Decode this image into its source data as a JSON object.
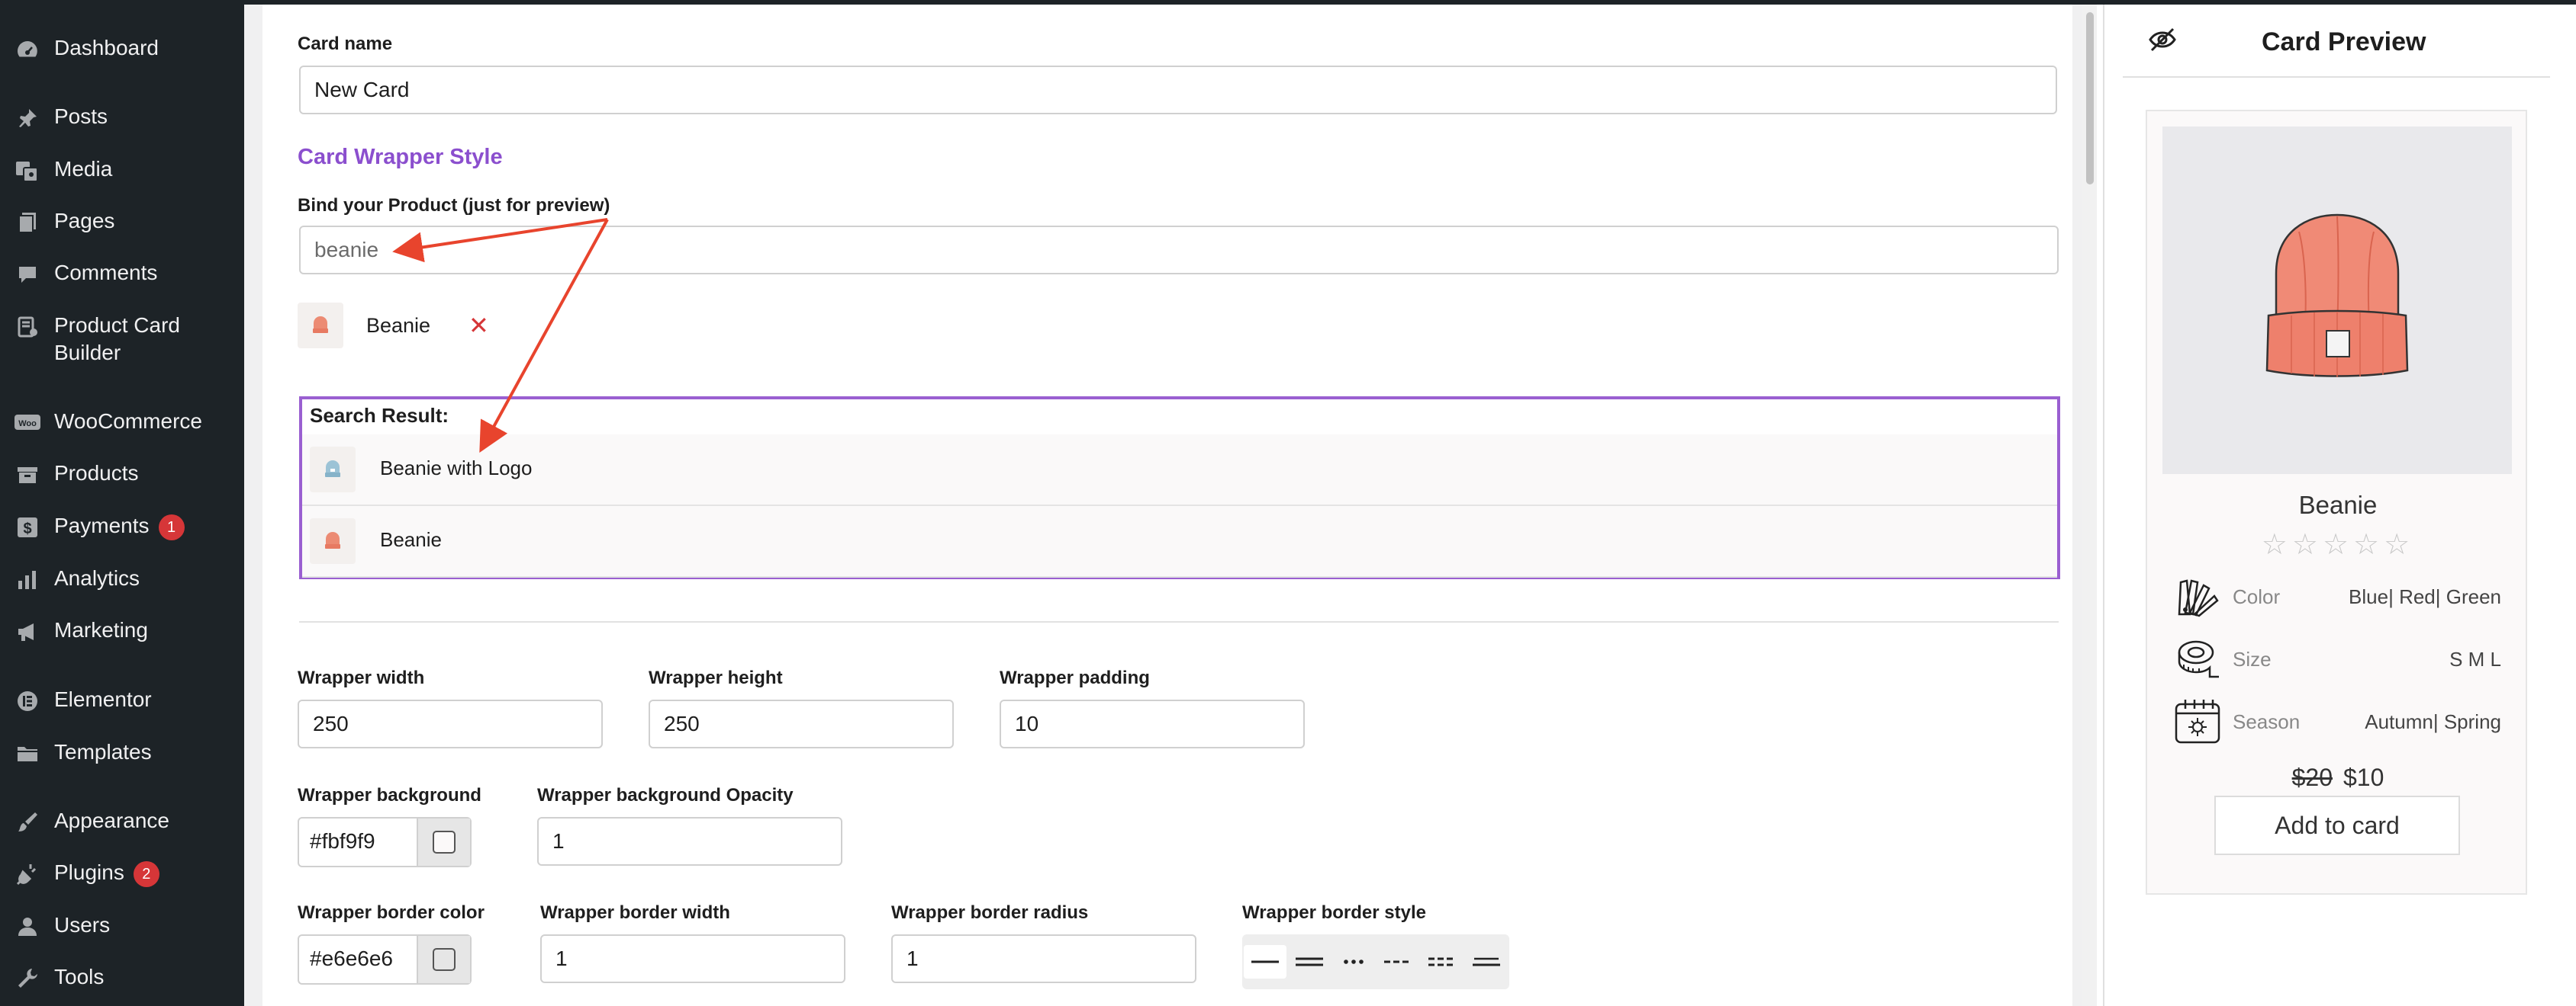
{
  "sidebar": {
    "items": [
      {
        "label": "Dashboard",
        "icon": "dashboard-icon"
      },
      {
        "label": "Posts",
        "icon": "pin-icon"
      },
      {
        "label": "Media",
        "icon": "media-icon"
      },
      {
        "label": "Pages",
        "icon": "pages-icon"
      },
      {
        "label": "Comments",
        "icon": "comment-icon"
      },
      {
        "label": "Product Card",
        "label2": "Builder",
        "icon": "builder-icon"
      },
      {
        "label": "WooCommerce",
        "icon": "woo-icon"
      },
      {
        "label": "Products",
        "icon": "archive-icon"
      },
      {
        "label": "Payments",
        "badge": "1",
        "icon": "dollar-icon"
      },
      {
        "label": "Analytics",
        "icon": "chart-icon"
      },
      {
        "label": "Marketing",
        "icon": "megaphone-icon"
      },
      {
        "label": "Elementor",
        "icon": "elementor-icon"
      },
      {
        "label": "Templates",
        "icon": "folder-icon"
      },
      {
        "label": "Appearance",
        "icon": "brush-icon"
      },
      {
        "label": "Plugins",
        "badge": "2",
        "icon": "plug-icon"
      },
      {
        "label": "Users",
        "icon": "user-icon"
      },
      {
        "label": "Tools",
        "icon": "wrench-icon"
      }
    ]
  },
  "form": {
    "card_name_label": "Card name",
    "card_name_value": "New Card",
    "section_title": "Card Wrapper Style",
    "bind_label": "Bind your Product (just for preview)",
    "bind_value": "beanie",
    "selected_product": "Beanie",
    "remove_symbol": "✕",
    "search_result_title": "Search Result:",
    "search_results": [
      "Beanie with Logo",
      "Beanie"
    ],
    "wrapper_width_label": "Wrapper width",
    "wrapper_width": "250",
    "wrapper_height_label": "Wrapper height",
    "wrapper_height": "250",
    "wrapper_padding_label": "Wrapper padding",
    "wrapper_padding": "10",
    "wrapper_background_label": "Wrapper background",
    "wrapper_background": "#fbf9f9",
    "wrapper_background_opacity_label": "Wrapper background Opacity",
    "wrapper_background_opacity": "1",
    "wrapper_border_color_label": "Wrapper border color",
    "wrapper_border_color": "#e6e6e6",
    "wrapper_border_width_label": "Wrapper border width",
    "wrapper_border_width": "1",
    "wrapper_border_radius_label": "Wrapper border radius",
    "wrapper_border_radius": "1",
    "wrapper_border_style_label": "Wrapper border style",
    "border_styles": [
      "solid",
      "double",
      "dotted",
      "dashed",
      "dashed-double",
      "double-thin"
    ]
  },
  "preview": {
    "title": "Card Preview",
    "product_name": "Beanie",
    "rating": {
      "value": 0,
      "max": 5
    },
    "attributes": [
      {
        "name": "Color",
        "value": "Blue| Red| Green",
        "icon": "palette-icon"
      },
      {
        "name": "Size",
        "value": "S M L",
        "icon": "tape-measure-icon"
      },
      {
        "name": "Season",
        "value": "Autumn| Spring",
        "icon": "calendar-icon"
      }
    ],
    "old_price": "$20",
    "price": "$10",
    "button_label": "Add to card"
  },
  "colors": {
    "sidebar": "#1d2327",
    "accent": "#8b4fce",
    "result_border": "#9a5fd1",
    "arrow": "#e8442d",
    "badge": "#d63638"
  }
}
